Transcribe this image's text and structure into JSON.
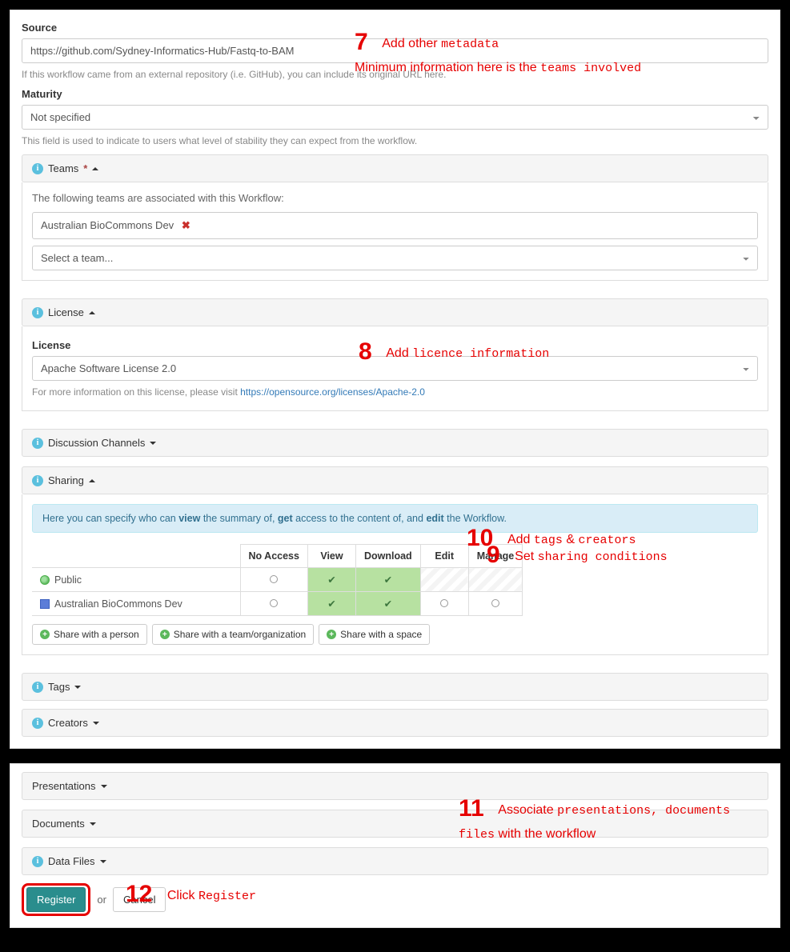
{
  "source": {
    "label": "Source",
    "value": "https://github.com/Sydney-Informatics-Hub/Fastq-to-BAM",
    "help": "If this workflow came from an external repository (i.e. GitHub), you can include its original URL here."
  },
  "maturity": {
    "label": "Maturity",
    "value": "Not specified",
    "help": "This field is used to indicate to users what level of stability they can expect from the workflow."
  },
  "teams": {
    "title": "Teams",
    "required_mark": "*",
    "intro": "The following teams are associated with this Workflow:",
    "selected": "Australian BioCommons Dev",
    "placeholder": "Select a team..."
  },
  "license": {
    "title": "License",
    "field_label": "License",
    "value": "Apache Software License 2.0",
    "help_prefix": "For more information on this license, please visit ",
    "help_link": "https://opensource.org/licenses/Apache-2.0"
  },
  "discussion": {
    "title": "Discussion Channels"
  },
  "sharing": {
    "title": "Sharing",
    "info_1": "Here you can specify who can ",
    "info_view": "view",
    "info_2": " the summary of, ",
    "info_get": "get",
    "info_3": " access to the content of, and ",
    "info_edit": "edit",
    "info_4": " the Workflow.",
    "cols": [
      "No Access",
      "View",
      "Download",
      "Edit",
      "Manage"
    ],
    "rows": [
      {
        "label": "Public",
        "icon": "globe"
      },
      {
        "label": "Australian BioCommons Dev",
        "icon": "org"
      }
    ],
    "share_person": "Share with a person",
    "share_team": "Share with a team/organization",
    "share_space": "Share with a space"
  },
  "tags": {
    "title": "Tags"
  },
  "creators": {
    "title": "Creators"
  },
  "presentations": {
    "title": "Presentations"
  },
  "documents": {
    "title": "Documents"
  },
  "datafiles": {
    "title": "Data Files"
  },
  "submit": {
    "register": "Register",
    "or": "or",
    "cancel": "Cancel"
  },
  "ann": {
    "a7_num": "7",
    "a7_l1a": "Add other ",
    "a7_l1b": "metadata",
    "a7_l2a": "Minimum information here is the ",
    "a7_l2b": "teams involved",
    "a8_num": "8",
    "a8_a": "Add ",
    "a8_b": "licence information",
    "a9_num": "9",
    "a9_a": "Set ",
    "a9_b": "sharing conditions",
    "a10_num": "10",
    "a10_a": "Add ",
    "a10_b": "tags",
    "a10_c": " & ",
    "a10_d": "creators",
    "a11_num": "11",
    "a11_a": "Associate ",
    "a11_b": "presentations, documents",
    "a11_c": "files",
    "a11_d": " with the workflow",
    "a12_num": "12",
    "a12_a": "Click ",
    "a12_b": "Register"
  }
}
